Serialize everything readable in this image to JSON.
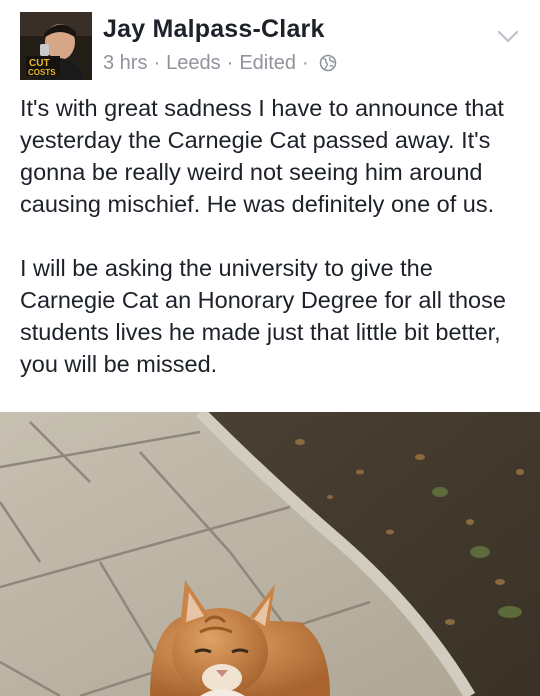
{
  "post": {
    "author": "Jay Malpass-Clark",
    "avatar_text": [
      "CUT",
      "COSTS"
    ],
    "time": "3 hrs",
    "location": "Leeds",
    "edited": "Edited",
    "dot": "·",
    "paragraphs": [
      "It's with great sadness I have to announce that yesterday the Carnegie Cat passed away. It's gonna be really weird not seeing him around causing mischief. He was definitely one of us.",
      "I will be asking the university to give the Carnegie Cat an Honorary Degree for all those students lives he made just that little bit better, you will be missed."
    ],
    "icons": {
      "privacy": "globe-icon",
      "menu": "chevron-down-icon"
    },
    "colors": {
      "text": "#1d2129",
      "meta": "#90949c"
    }
  }
}
